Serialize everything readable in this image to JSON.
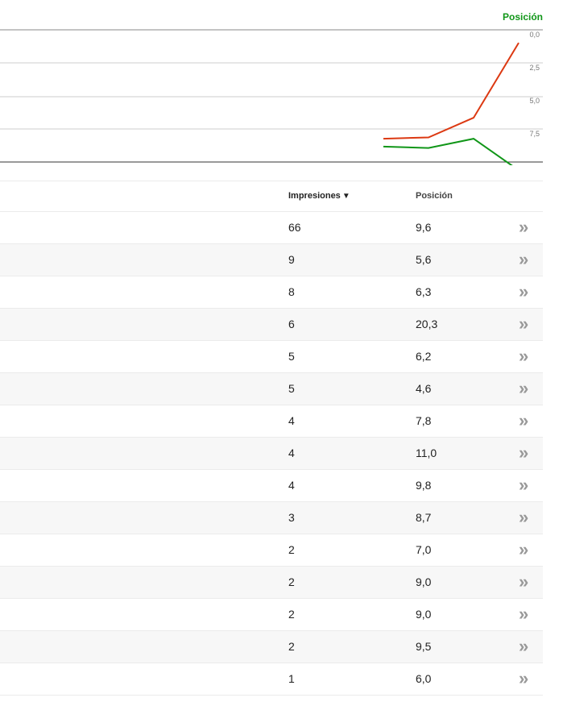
{
  "chart": {
    "legend_label": "Posición",
    "axis_ticks": [
      "0,0",
      "2,5",
      "5,0",
      "7,5"
    ],
    "colors": {
      "position_series": "#109618",
      "other_series": "#dc3912",
      "grid": "#cccccc",
      "axis": "#333333"
    }
  },
  "chart_data": {
    "type": "line",
    "ylabel_right": "Posición",
    "y_right_ticks": [
      "0,0",
      "2,5",
      "5,0",
      "7,5"
    ],
    "y_right_reversed": true,
    "series": [
      {
        "name": "Posición",
        "color": "#109618",
        "values": [
          8.4,
          8.5,
          7.8,
          10.2
        ]
      },
      {
        "color": "#dc3912",
        "values": [
          7.8,
          7.7,
          6.2,
          0.5
        ]
      }
    ]
  },
  "table": {
    "columns": {
      "impressions": "Impresiones",
      "position": "Posición"
    },
    "sort_indicator": "▼",
    "arrow_glyph": "»",
    "rows": [
      {
        "impressions": "66",
        "position": "9,6"
      },
      {
        "impressions": "9",
        "position": "5,6"
      },
      {
        "impressions": "8",
        "position": "6,3"
      },
      {
        "impressions": "6",
        "position": "20,3"
      },
      {
        "impressions": "5",
        "position": "6,2"
      },
      {
        "impressions": "5",
        "position": "4,6"
      },
      {
        "impressions": "4",
        "position": "7,8"
      },
      {
        "impressions": "4",
        "position": "11,0"
      },
      {
        "impressions": "4",
        "position": "9,8"
      },
      {
        "impressions": "3",
        "position": "8,7"
      },
      {
        "impressions": "2",
        "position": "7,0"
      },
      {
        "impressions": "2",
        "position": "9,0"
      },
      {
        "impressions": "2",
        "position": "9,0"
      },
      {
        "impressions": "2",
        "position": "9,5"
      },
      {
        "impressions": "1",
        "position": "6,0"
      }
    ]
  }
}
